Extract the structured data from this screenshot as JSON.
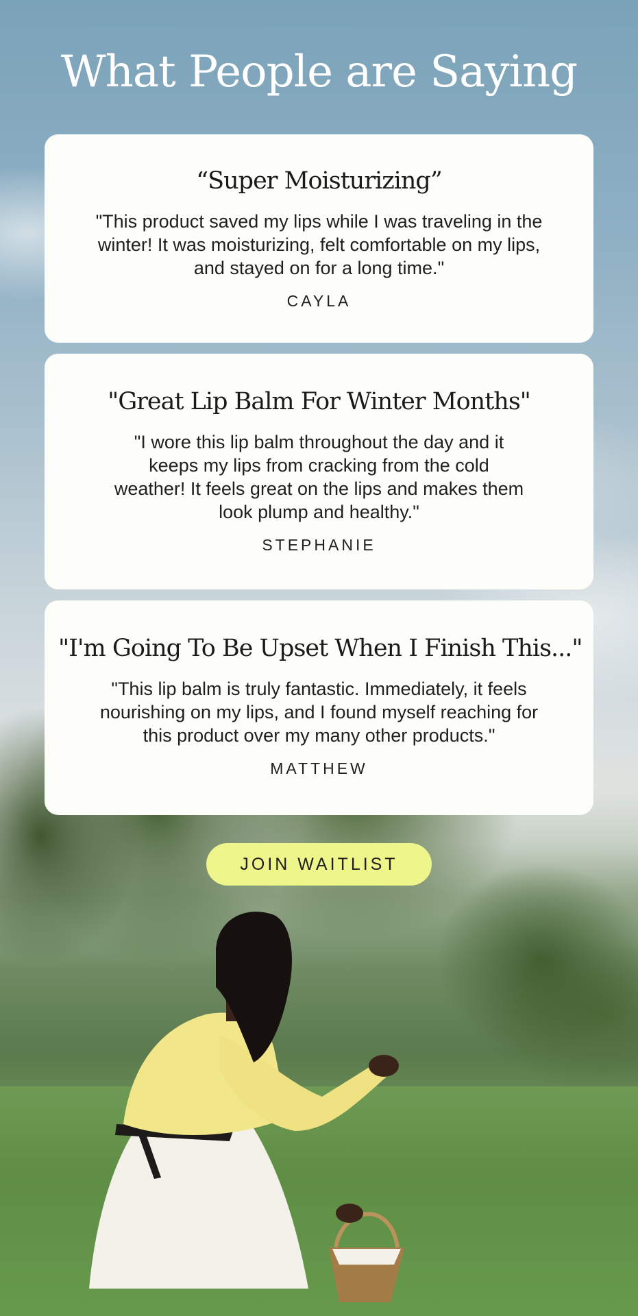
{
  "heading": "What People are Saying",
  "testimonials": [
    {
      "title": "“Super Moisturizing”",
      "quote": "\"This product saved my lips while I was traveling in the winter! It was moisturizing, felt comfortable on my lips, and stayed on for a long time.\"",
      "author": "CAYLA"
    },
    {
      "title": "\"Great Lip Balm For Winter Months\"",
      "quote": "\"I wore this lip balm throughout the day and it keeps my lips from cracking from the cold weather! It feels great on the lips and makes them look plump and healthy.\"",
      "author": "STEPHANIE"
    },
    {
      "title": "\"I'm Going To Be Upset When I Finish This...\"",
      "quote": "\"This lip balm is truly fantastic. Immediately, it feels nourishing on my lips, and I found myself reaching for this product over my many other products.\"",
      "author": "MATTHEW"
    }
  ],
  "cta": {
    "label": "JOIN WAITLIST",
    "color": "#eef58a"
  },
  "colors": {
    "card_background": "#fdfdf9",
    "heading_text": "#ffffff"
  }
}
